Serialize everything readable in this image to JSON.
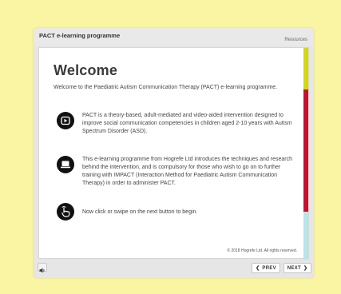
{
  "header": {
    "title": "PACT e-learning programme",
    "resources_label": "Resources"
  },
  "slide": {
    "heading": "Welcome",
    "intro": "Welcome to the Paediatric Autism Communication Therapy (PACT) e-learning programme.",
    "items": [
      {
        "icon": "play-icon",
        "text": "PACT is a theory-based, adult-mediated and video-aided intervention designed to improve social communication competencies in children aged 2-10 years with Autism Spectrum Disorder (ASD)."
      },
      {
        "icon": "laptop-icon",
        "text": "This e-learning programme from Hogrefe Ltd introduces the techniques and research behind the intervention, and is compulsory for those who wish to go on to further training with IMPACT (Interaction Method for Paediatric Autism Communication Therapy) in order to administer PACT."
      },
      {
        "icon": "tap-hand-icon",
        "text": "Now click or swipe on the next button to begin."
      }
    ],
    "copyright": "© 2018 Hogrefe Ltd. All rights reserved.",
    "progress_stripe_colors": [
      "#d6d80e",
      "#c8102e",
      "#b7e6ea"
    ]
  },
  "controls": {
    "volume_icon": "speaker-icon",
    "prev_label": "PREV",
    "next_label": "NEXT"
  },
  "colors": {
    "background": "#faf5a2",
    "accent_yellow": "#d6d80e",
    "accent_red": "#c8102e",
    "accent_teal": "#b7e6ea"
  }
}
